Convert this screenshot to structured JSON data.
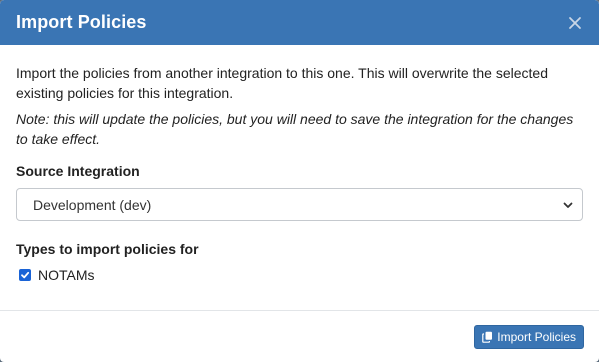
{
  "dialog": {
    "title": "Import Policies",
    "close_icon": "close-icon"
  },
  "body": {
    "description": "Import the policies from another integration to this one. This will overwrite the selected existing policies for this integration.",
    "note": "Note: this will update the policies, but you will need to save the integration for the changes to take effect.",
    "source_label": "Source Integration",
    "source_value": "Development (dev)",
    "types_label": "Types to import policies for",
    "types": [
      {
        "label": "NOTAMs",
        "checked": true
      }
    ]
  },
  "footer": {
    "import_button_label": "Import Policies",
    "import_button_icon": "copy-icon"
  },
  "colors": {
    "header": "#3a75b4",
    "primary": "#3a75b4",
    "checkbox": "#1a63d6"
  }
}
